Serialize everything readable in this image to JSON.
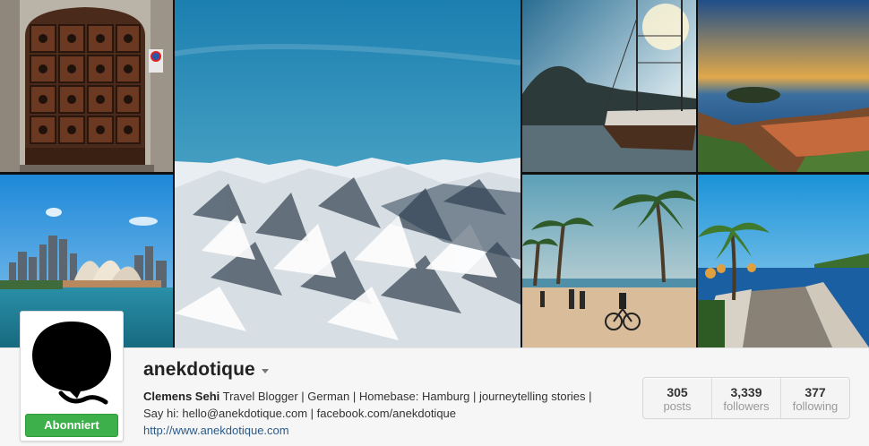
{
  "profile": {
    "username": "anekdotique",
    "follow_button_label": "Abonniert",
    "bio": {
      "name": "Clemens Sehi",
      "line1": " Travel Blogger | German | Homebase: Hamburg | journeytelling stories |",
      "line2": "Say hi: hello@anekdotique.com | facebook.com/anekdotique",
      "website": "http://www.anekdotique.com"
    }
  },
  "stats": [
    {
      "count": "305",
      "label": "posts"
    },
    {
      "count": "3,339",
      "label": "followers"
    },
    {
      "count": "377",
      "label": "following"
    }
  ],
  "colors": {
    "follow_button": "#3eb04b",
    "link": "#2a5a8a",
    "profile_bar": "#f6f6f6"
  },
  "mosaic": {
    "photos": [
      "door-photo",
      "opera-house-photo",
      "snowy-mountains-photo",
      "sailing-ship-photo",
      "island-coast-photo",
      "palm-promenade-photo",
      "coastal-walkway-photo"
    ]
  },
  "icons": {
    "caret": "chevron-down-icon"
  }
}
